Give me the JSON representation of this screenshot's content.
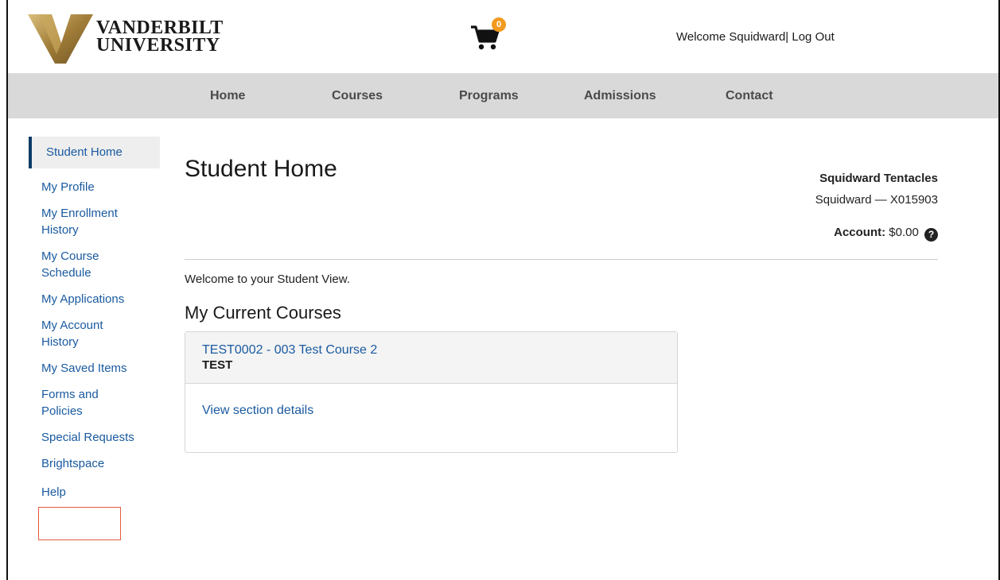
{
  "header": {
    "logo_line1": "VANDERBILT",
    "logo_line2": "UNIVERSITY",
    "cart_count": "0",
    "welcome_text": "Welcome Squidward",
    "separator": "|",
    "logout_label": "Log Out"
  },
  "nav": {
    "items": [
      "Home",
      "Courses",
      "Programs",
      "Admissions",
      "Contact"
    ]
  },
  "sidebar": {
    "items": [
      {
        "label": "Student Home"
      },
      {
        "label": "My Profile"
      },
      {
        "label": "My Enrollment History"
      },
      {
        "label": "My Course Schedule"
      },
      {
        "label": "My Applications"
      },
      {
        "label": "My Account History"
      },
      {
        "label": "My Saved Items"
      },
      {
        "label": "Forms and Policies"
      },
      {
        "label": "Special Requests"
      },
      {
        "label": "Brightspace"
      },
      {
        "label": "Help"
      }
    ]
  },
  "main": {
    "title": "Student Home",
    "student_name": "Squidward Tentacles",
    "student_id": "Squidward — X015903",
    "account_label": "Account:",
    "account_value": "$0.00",
    "welcome_message": "Welcome to your Student View.",
    "current_courses_title": "My Current Courses",
    "course": {
      "title": "TEST0002 - 003 Test Course 2",
      "subtitle": "TEST",
      "details_link": "View section details"
    }
  },
  "colors": {
    "link": "#1a5aa0",
    "nav_bg": "#d9d9d9",
    "badge": "#f29a1f",
    "highlight": "#e35b3e",
    "brand_gold": "#b08a3e"
  }
}
